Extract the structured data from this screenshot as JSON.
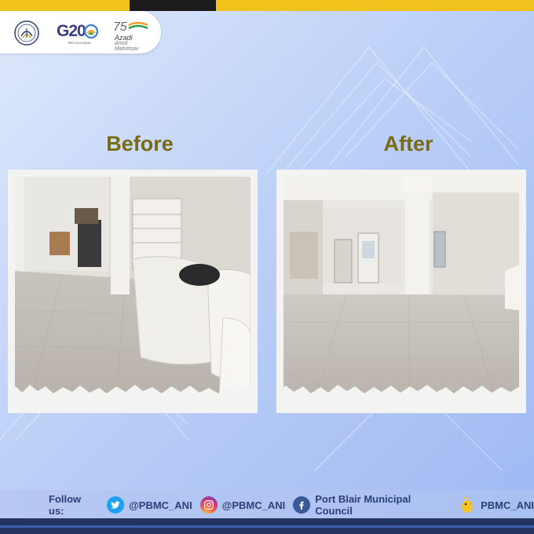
{
  "header": {
    "logos": [
      {
        "icon": "emblem-icon"
      },
      {
        "text": "G20",
        "subtext": "भारत 2023 INDIA"
      },
      {
        "number": "75",
        "line1": "Azadi",
        "line2": "Amrit Mahotsav"
      }
    ]
  },
  "labels": {
    "before": "Before",
    "after": "After"
  },
  "footer": {
    "follow": "Follow us:",
    "items": [
      {
        "icon": "twitter-icon",
        "text": "@PBMC_ANI"
      },
      {
        "icon": "instagram-icon",
        "text": "@PBMC_ANI"
      },
      {
        "icon": "facebook-icon",
        "text": "Port Blair Municipal Council"
      },
      {
        "icon": "koo-icon",
        "text": "PBMC_ANI"
      }
    ]
  },
  "colors": {
    "accent_yellow": "#f1c21b",
    "label_gold": "#7a6a12",
    "footer_text": "#2b3f78"
  }
}
